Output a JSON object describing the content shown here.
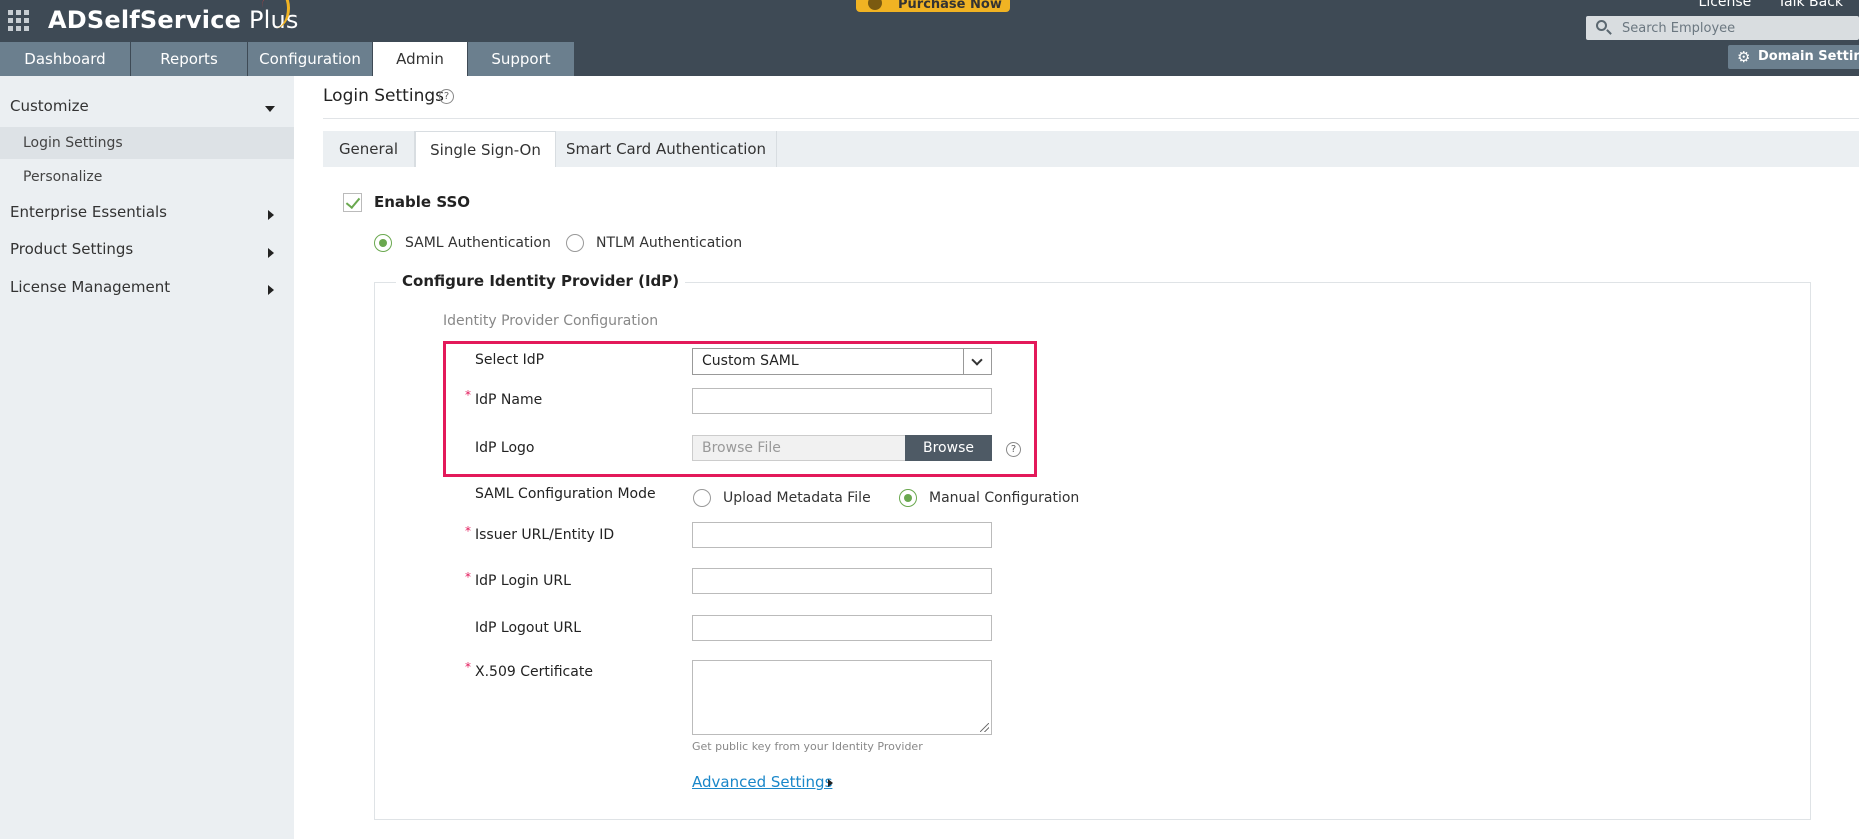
{
  "header": {
    "brand": "ADSelfService",
    "brand_suffix": " Plus",
    "purchase_label": "Purchase Now",
    "links": [
      "License",
      "Talk Back"
    ],
    "search_placeholder": "Search Employee",
    "domain_settings_label": "Domain Settings"
  },
  "nav": {
    "tabs": [
      {
        "label": "Dashboard",
        "active": false
      },
      {
        "label": "Reports",
        "active": false
      },
      {
        "label": "Configuration",
        "active": false
      },
      {
        "label": "Admin",
        "active": true
      },
      {
        "label": "Support",
        "active": false
      }
    ]
  },
  "sidebar": {
    "customize": "Customize",
    "items": [
      {
        "label": "Login Settings",
        "active": true
      },
      {
        "label": "Personalize",
        "active": false
      }
    ],
    "sections": [
      "Enterprise Essentials",
      "Product Settings",
      "License Management"
    ]
  },
  "main": {
    "page_title": "Login Settings",
    "tabs": [
      {
        "label": "General",
        "active": false
      },
      {
        "label": "Single Sign-On",
        "active": true
      },
      {
        "label": "Smart Card Authentication",
        "active": false
      }
    ],
    "enable_sso_label": "Enable SSO",
    "enable_sso_checked": true,
    "auth_options": [
      {
        "label": "SAML Authentication",
        "selected": true
      },
      {
        "label": "NTLM Authentication",
        "selected": false
      }
    ],
    "fieldset_title": "Configure Identity Provider (IdP)",
    "section_heading": "Identity Provider Configuration",
    "fields": {
      "select_idp": {
        "label": "Select IdP",
        "value": "Custom SAML"
      },
      "idp_name": {
        "label": "IdP Name",
        "value": ""
      },
      "idp_logo": {
        "label": "IdP Logo",
        "placeholder": "Browse File",
        "button": "Browse"
      },
      "saml_mode": {
        "label": "SAML Configuration Mode",
        "options": [
          {
            "label": "Upload Metadata File",
            "selected": false
          },
          {
            "label": "Manual Configuration",
            "selected": true
          }
        ]
      },
      "issuer_url": {
        "label": "Issuer URL/Entity ID",
        "value": ""
      },
      "login_url": {
        "label": "IdP Login URL",
        "value": ""
      },
      "logout_url": {
        "label": "IdP Logout URL",
        "value": ""
      },
      "certificate": {
        "label": "X.509 Certificate",
        "value": "",
        "hint": "Get public key from your Identity Provider"
      }
    },
    "advanced_link": "Advanced Settings"
  },
  "colors": {
    "header_bg": "#3e4a55",
    "nav_tab_bg": "#6b7f8e",
    "accent_green": "#6aa84f",
    "highlight_border": "#e3195a",
    "link_blue": "#1a87c9",
    "purchase_yellow": "#f0b323"
  }
}
